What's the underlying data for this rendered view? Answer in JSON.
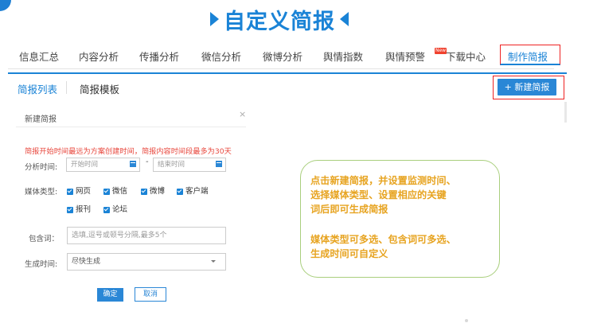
{
  "banner": {
    "title": "自定义简报"
  },
  "nav": {
    "items": [
      "信息汇总",
      "内容分析",
      "传播分析",
      "微信分析",
      "微博分析",
      "舆情指数",
      "舆情预警",
      "下载中心",
      "制作简报"
    ],
    "badge": "New",
    "active": "制作简报"
  },
  "subtabs": {
    "list": "简报列表",
    "template": "简报模板"
  },
  "new_button": "+ 新建简报",
  "panel": {
    "title": "新建简报",
    "close": "×",
    "warning": "简报开始时间最远为方案创建时间，简报内容时间段最多为30天",
    "analysis_time_label": "分析时间:",
    "start_placeholder": "开始时间",
    "end_placeholder": "结束时间",
    "dash": "-",
    "media_label": "媒体类型:",
    "media": [
      "网页",
      "微信",
      "微博",
      "客户端",
      "报刊",
      "论坛"
    ],
    "include_label": "包含词：",
    "include_placeholder": "选填,逗号或顿号分隔,最多5个",
    "generate_label": "生成时间:",
    "generate_value": "尽快生成",
    "ok": "确定",
    "cancel": "取消"
  },
  "callout": {
    "lines1": [
      "点击新建简报，并设置监测时间、",
      "选择媒体类型、设置相应的关键",
      "词后即可生成简报"
    ],
    "lines2": [
      "媒体类型可多选、包含词可多选、",
      "生成时间可自定义"
    ]
  },
  "colors": {
    "accent": "#1a83d6",
    "warning": "#e8483e",
    "callout_text": "#e7a421",
    "callout_border": "#a9cf7d",
    "highlight": "#ee2222"
  }
}
